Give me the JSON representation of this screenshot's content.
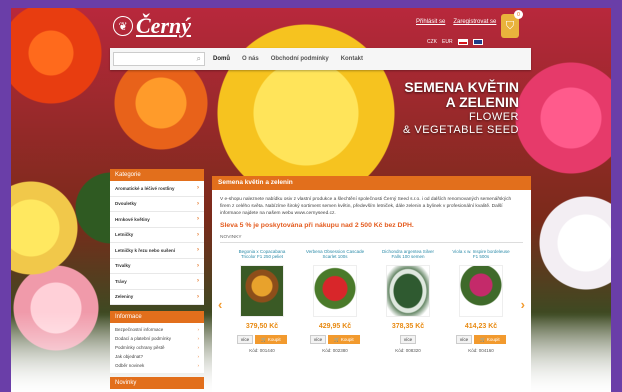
{
  "header": {
    "brand": "Černý",
    "logo_icon": "leaf-emblem-icon",
    "links": [
      "Přihlásit se",
      "Zaregistrovat se"
    ],
    "lang": {
      "currency_czk": "CZK",
      "currency_eur": "EUR"
    },
    "cart_count": "0"
  },
  "search": {
    "placeholder": ""
  },
  "nav": [
    "Domů",
    "O nás",
    "Obchodní podmínky",
    "Kontakt"
  ],
  "hero": {
    "line1": "SEMENA KVĚTIN",
    "line2": "A ZELENIN",
    "line3": "FLOWER",
    "line4": "& VEGETABLE SEED"
  },
  "sidebar": {
    "categories_title": "Kategorie",
    "categories": [
      "Aromatické a léčivé rostliny",
      "Dvouletky",
      "Hrnkové květiny",
      "Letničky",
      "Letničky k řezu nebo sušení",
      "Trvalky",
      "Trávy",
      "Zeleniny"
    ],
    "info_title": "Informace",
    "info": [
      "Bezpečnostní informace",
      "Dodací a platební podmínky",
      "Podmínky ochrany pěstě",
      "Jak objednat?",
      "Odběr novinek"
    ],
    "third_title": "Novinky"
  },
  "main": {
    "title": "Semena květin a zelenin",
    "intro": "V e-shopu naleznete nabídku osiv z vlastní produkce a šlechtění společnosti Černý Seed s.r.o. i od dalších renomovaných semenářských firem z celého světa. Nabízíme široký sortiment semen květin, především letniček, dále zelenin a bylinek v profesionální kvalitě. Další informace najdete na našem webu www.cernyseed.cz.",
    "promo": "Sleva 5 % je poskytována při nákupu nad 2 500 Kč bez DPH.",
    "section": "NOVINKY"
  },
  "products": [
    {
      "name": "Begonia x Copacabana Tricolor F1 250 peliet",
      "price": "379,50 Kč",
      "more": "více",
      "buy": "Koupit",
      "code": "Kód: 001440"
    },
    {
      "name": "Verbena Obsession Cascade Scarlet 100s",
      "price": "429,95 Kč",
      "more": "více",
      "buy": "Koupit",
      "code": "Kód: 002380"
    },
    {
      "name": "Dichondra argentea Silver Falls 100 semen",
      "price": "378,35 Kč",
      "more": "více",
      "buy": "Koupit",
      "code": "Kód: 008320"
    },
    {
      "name": "Viola x w. Inspire bordeleuse F1 500s",
      "price": "414,23 Kč",
      "more": "více",
      "buy": "Koupit",
      "code": "Kód: 004160"
    }
  ],
  "colors": {
    "accent": "#e26f1c",
    "price": "#e88a12",
    "link": "#2a8aa8",
    "frame": "#6a3ea8"
  }
}
